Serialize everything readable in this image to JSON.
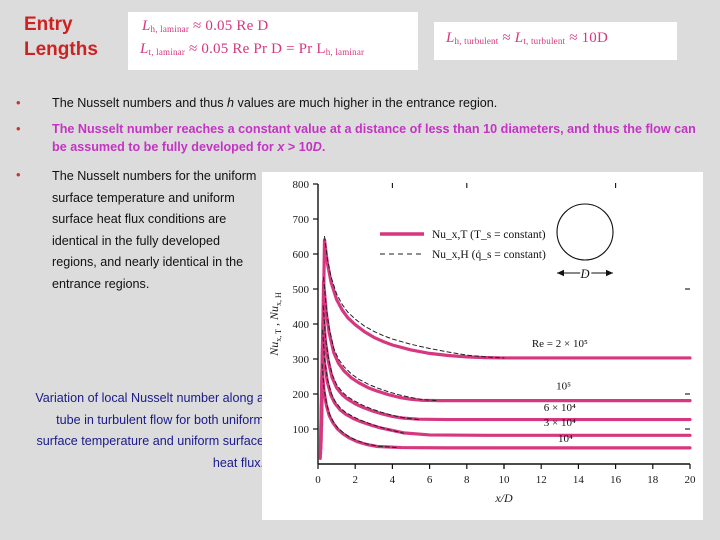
{
  "slide": {
    "title_line1": "Entry",
    "title_line2": "Lengths",
    "background": "#dcdcdc",
    "title_color": "#cc2222"
  },
  "formulas": {
    "laminar": {
      "line1": {
        "lhs": "L",
        "lhs_sub": "h, laminar",
        "rel": "≈",
        "rhs": "0.05 Re D"
      },
      "line2": {
        "lhs": "L",
        "lhs_sub": "t, laminar",
        "rel": "≈",
        "rhs": "0.05 Re Pr D = Pr L",
        "rhs_sub": "h, laminar"
      }
    },
    "turbulent": {
      "line1": {
        "lhs": "L",
        "lhs_sub": "h, turbulent",
        "rel1": "≈",
        "mid": "L",
        "mid_sub": "t, turbulent",
        "rel2": "≈",
        "rhs": "10D"
      }
    },
    "color": "#d6377f"
  },
  "bullets": [
    {
      "marker": "•",
      "color": "#111111",
      "text_parts": [
        "The Nusselt numbers and thus ",
        "h",
        " values are much higher in the entrance region."
      ],
      "italic_index": 1
    },
    {
      "marker": "•",
      "color": "#c433c4",
      "text_parts": [
        "The Nusselt number reaches a constant value at a distance of less than 10 diameters, and thus the flow can be assumed to be fully developed for ",
        "x",
        " > 10",
        "D",
        "."
      ],
      "italic_index": 1
    },
    {
      "marker": "•",
      "color": "#111111",
      "text": "The Nusselt numbers for the uniform surface temperature and uniform surface heat flux conditions are identical in the fully developed regions, and nearly identical in the entrance regions."
    }
  ],
  "caption": {
    "text": "Variation of local Nusselt number along a tube in turbulent flow for both uniform surface temperature and uniform surface heat flux.",
    "color": "#1a1a8c"
  },
  "chart_data": {
    "type": "line",
    "title": "",
    "xlabel": "x/D",
    "ylabel": "Nu_x,T , Nu_x,H",
    "xlim": [
      0,
      20
    ],
    "ylim": [
      0,
      800
    ],
    "xticks": [
      0,
      2,
      4,
      6,
      8,
      10,
      12,
      14,
      16,
      18,
      20
    ],
    "yticks": [
      100,
      200,
      300,
      400,
      500,
      600,
      700,
      800
    ],
    "grid": false,
    "legend_position": "upper-left-inside",
    "legend": [
      {
        "label": "Nu_x,T (T_s = constant)",
        "style": "solid",
        "color": "#d6377f"
      },
      {
        "label": "Nu_x,H (q̇_s = constant)",
        "style": "dashed",
        "color": "#222222"
      }
    ],
    "annotations": [
      {
        "text": "Re = 2 × 10⁵",
        "x": 13.0,
        "y": 335
      },
      {
        "text": "10⁵",
        "x": 13.2,
        "y": 213
      },
      {
        "text": "6 × 10⁴",
        "x": 13.0,
        "y": 152
      },
      {
        "text": "3 × 10⁴",
        "x": 13.0,
        "y": 108
      },
      {
        "text": "10⁴",
        "x": 13.3,
        "y": 63
      },
      {
        "text": "D",
        "x": 15.2,
        "y": 527
      }
    ],
    "series": [
      {
        "name": "Re = 2 × 10⁵",
        "style": "solid",
        "color": "#d6377f",
        "plateau": 303,
        "x": [
          0.35,
          0.5,
          0.7,
          1.0,
          1.3,
          1.6,
          2.0,
          2.5,
          3.0,
          3.5,
          4.0,
          5.0,
          6.0,
          7.0,
          8.0,
          9.0,
          10.0,
          12.0,
          14.0,
          16.0,
          18.0,
          20.0
        ],
        "y": [
          640,
          575,
          520,
          470,
          440,
          418,
          398,
          378,
          362,
          350,
          340,
          326,
          316,
          310,
          306,
          304,
          303,
          303,
          303,
          303,
          303,
          303
        ]
      },
      {
        "name": "Re = 2 × 10⁵ (H)",
        "style": "dashed",
        "color": "#222222",
        "plateau": 303,
        "x": [
          0.35,
          0.5,
          0.7,
          1.0,
          1.3,
          1.6,
          2.0,
          2.5,
          3.0,
          3.5,
          4.0,
          5.0,
          6.0,
          7.0,
          8.0,
          9.0,
          10.0
        ],
        "y": [
          650,
          588,
          535,
          486,
          456,
          434,
          414,
          394,
          379,
          367,
          357,
          342,
          330,
          320,
          311,
          306,
          303
        ]
      },
      {
        "name": "Re = 10⁵",
        "style": "solid",
        "color": "#d6377f",
        "plateau": 181,
        "x": [
          0.3,
          0.45,
          0.6,
          0.85,
          1.1,
          1.4,
          1.8,
          2.2,
          2.7,
          3.2,
          3.8,
          4.4,
          5.0,
          5.6,
          6.5,
          8.0,
          10.0,
          14.0,
          20.0
        ],
        "y": [
          520,
          430,
          375,
          318,
          288,
          266,
          246,
          232,
          218,
          208,
          198,
          190,
          185,
          182,
          181,
          181,
          181,
          181,
          181
        ]
      },
      {
        "name": "Re = 10⁵ (H)",
        "style": "dashed",
        "color": "#222222",
        "plateau": 181,
        "x": [
          0.3,
          0.45,
          0.6,
          0.85,
          1.1,
          1.4,
          1.8,
          2.2,
          2.7,
          3.2,
          3.8,
          4.4,
          5.0,
          5.6,
          6.5
        ],
        "y": [
          533,
          444,
          388,
          330,
          300,
          278,
          257,
          242,
          228,
          217,
          206,
          197,
          190,
          184,
          181
        ]
      },
      {
        "name": "Re = 6 × 10⁴",
        "style": "solid",
        "color": "#d6377f",
        "plateau": 127,
        "x": [
          0.28,
          0.4,
          0.55,
          0.75,
          1.0,
          1.3,
          1.6,
          2.0,
          2.4,
          2.9,
          3.4,
          4.0,
          4.6,
          5.4,
          7.0,
          10.0,
          14.0,
          20.0
        ],
        "y": [
          440,
          350,
          295,
          248,
          218,
          198,
          185,
          172,
          162,
          152,
          144,
          136,
          131,
          128,
          127,
          127,
          127,
          127
        ]
      },
      {
        "name": "Re = 6 × 10⁴ (H)",
        "style": "dashed",
        "color": "#222222",
        "plateau": 127,
        "x": [
          0.28,
          0.4,
          0.55,
          0.75,
          1.0,
          1.3,
          1.6,
          2.0,
          2.4,
          2.9,
          3.4,
          4.0,
          4.6,
          5.4
        ],
        "y": [
          452,
          362,
          306,
          258,
          227,
          206,
          192,
          179,
          168,
          157,
          148,
          139,
          132,
          127
        ]
      },
      {
        "name": "Re = 3 × 10⁴",
        "style": "solid",
        "color": "#d6377f",
        "plateau": 82,
        "x": [
          0.25,
          0.35,
          0.5,
          0.7,
          0.9,
          1.2,
          1.5,
          1.9,
          2.3,
          2.8,
          3.3,
          3.9,
          4.6,
          6.0,
          9.0,
          14.0,
          20.0
        ],
        "y": [
          370,
          290,
          235,
          196,
          174,
          154,
          142,
          130,
          121,
          112,
          104,
          97,
          89,
          83,
          82,
          82,
          82
        ]
      },
      {
        "name": "Re = 3 × 10⁴ (H)",
        "style": "dashed",
        "color": "#222222",
        "plateau": 82,
        "x": [
          0.25,
          0.35,
          0.5,
          0.7,
          0.9,
          1.2,
          1.5,
          1.9,
          2.3,
          2.8,
          3.3,
          3.9,
          4.6
        ],
        "y": [
          382,
          300,
          245,
          204,
          181,
          160,
          147,
          135,
          125,
          115,
          106,
          97,
          88
        ]
      },
      {
        "name": "Re = 10⁴",
        "style": "solid",
        "color": "#d6377f",
        "plateau": 46,
        "x": [
          0.22,
          0.32,
          0.45,
          0.6,
          0.8,
          1.05,
          1.35,
          1.7,
          2.1,
          2.6,
          3.2,
          4.5,
          7.0,
          12.0,
          20.0
        ],
        "y": [
          275,
          210,
          168,
          139,
          118,
          100,
          86,
          74,
          64,
          56,
          50,
          47,
          46,
          46,
          46
        ]
      },
      {
        "name": "Re = 10⁴ (H)",
        "style": "dashed",
        "color": "#222222",
        "plateau": 46,
        "x": [
          0.22,
          0.32,
          0.45,
          0.6,
          0.8,
          1.05,
          1.35,
          1.7,
          2.1,
          2.6,
          3.2,
          4.2
        ],
        "y": [
          285,
          218,
          175,
          145,
          123,
          104,
          90,
          77,
          67,
          58,
          51,
          47
        ]
      }
    ]
  }
}
